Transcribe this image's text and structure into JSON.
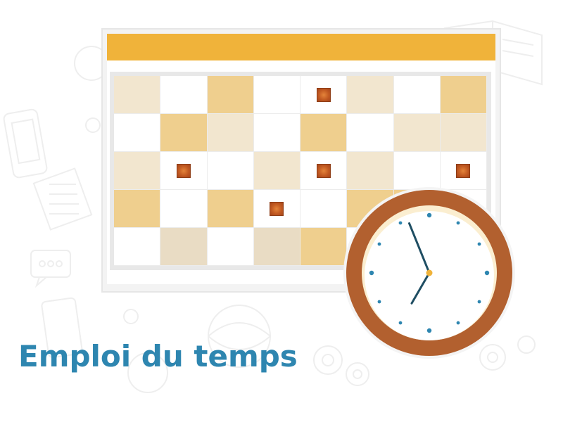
{
  "title": "Emploi du temps",
  "colors": {
    "header": "#f0b33a",
    "title": "#2e86b0",
    "clock_ring": "#b2602f",
    "event": "#c25a22",
    "cell_light": "#f2e6cf",
    "cell_medium": "#efcf8e"
  },
  "calendar": {
    "rows": [
      [
        "light",
        "white",
        "medium",
        "white",
        "white-event",
        "light",
        "white",
        "medium"
      ],
      [
        "white",
        "medium",
        "light",
        "white",
        "medium",
        "white",
        "light",
        "light"
      ],
      [
        "light",
        "white-event",
        "white",
        "light",
        "white-event",
        "light",
        "white",
        "white-event"
      ],
      [
        "medium",
        "white",
        "medium",
        "white-event",
        "white",
        "medium",
        "medium",
        "white"
      ],
      [
        "white",
        "beige",
        "white",
        "beige",
        "medium",
        "white",
        "white",
        "white"
      ]
    ]
  },
  "clock": {
    "icon": "clock-icon",
    "hour_hand_angle_deg": 210,
    "minute_hand_angle_deg": 338
  },
  "background_icons": [
    "phone-icon",
    "building-icon",
    "chat-bubble-icon",
    "book-icon",
    "gear-icon",
    "globe-icon"
  ]
}
